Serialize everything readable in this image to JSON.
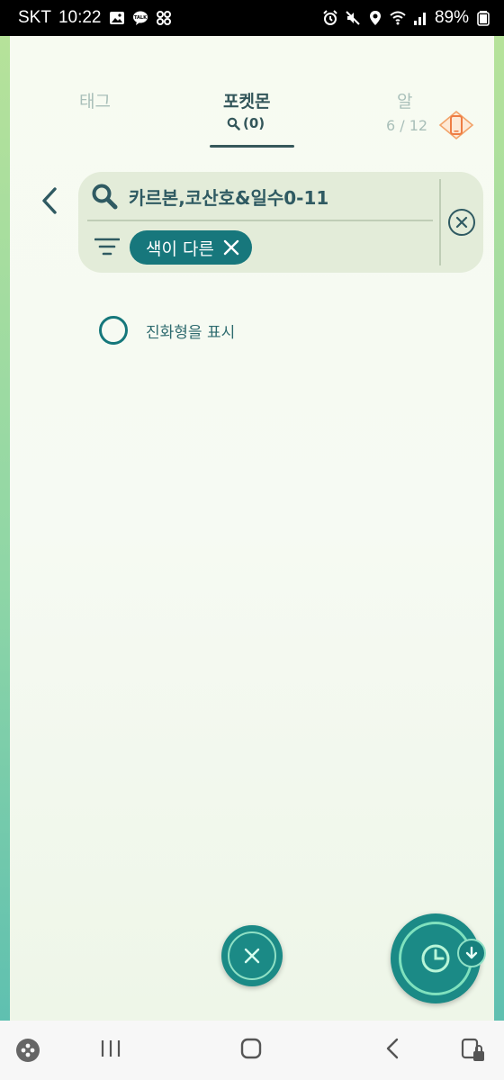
{
  "status_bar": {
    "carrier": "SKT",
    "time": "10:22",
    "battery": "89%"
  },
  "tabs": {
    "tags": "태그",
    "pokemon": "포켓몬",
    "pokemon_count": "(0)",
    "eggs": "알",
    "egg_count": "6 / 12"
  },
  "search": {
    "query": "카르본,코산호&일수0-11",
    "filter_chip": "색이 다른"
  },
  "options": {
    "show_evolutions": "진화형을 표시"
  },
  "colors": {
    "accent": "#17777c",
    "text_dark": "#33565a",
    "tab_inactive": "#a9bfb9",
    "panel_bg": "#e3ecd9"
  }
}
